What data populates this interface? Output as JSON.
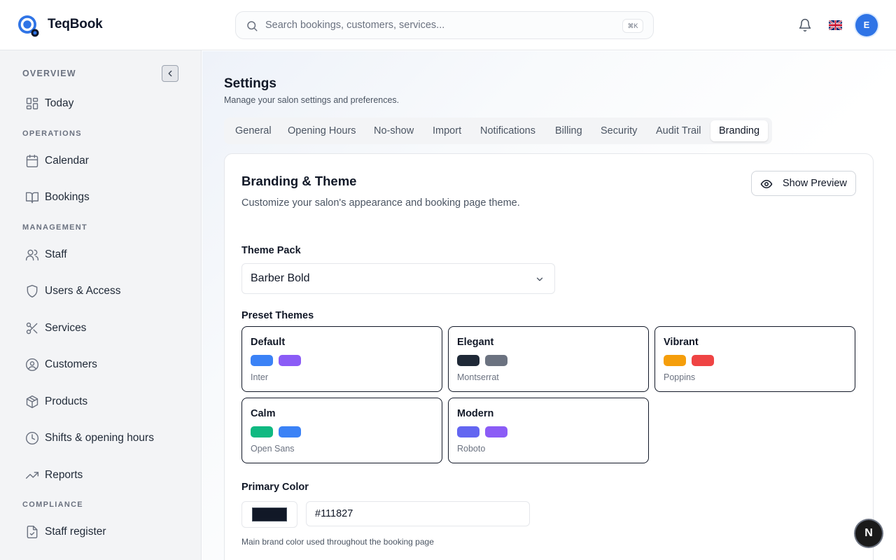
{
  "app": {
    "name": "TeqBook",
    "brand_color": "#2f74e6"
  },
  "header": {
    "search_placeholder": "Search bookings, customers, services...",
    "search_shortcut": "⌘K",
    "avatar_initial": "E",
    "language_flag": "uk-flag-icon"
  },
  "sidebar": {
    "sections": {
      "overview": "OVERVIEW",
      "operations": "OPERATIONS",
      "management": "MANAGEMENT",
      "compliance": "COMPLIANCE"
    },
    "items": {
      "today": "Today",
      "calendar": "Calendar",
      "bookings": "Bookings",
      "staff": "Staff",
      "users_access": "Users & Access",
      "services": "Services",
      "customers": "Customers",
      "products": "Products",
      "shifts": "Shifts & opening hours",
      "reports": "Reports",
      "staff_register": "Staff register"
    }
  },
  "page": {
    "title": "Settings",
    "subtitle": "Manage your salon settings and preferences."
  },
  "tabs": [
    "General",
    "Opening Hours",
    "No-show",
    "Import",
    "Notifications",
    "Billing",
    "Security",
    "Audit Trail",
    "Branding"
  ],
  "active_tab": "Branding",
  "branding": {
    "title": "Branding & Theme",
    "subtitle": "Customize your salon's appearance and booking page theme.",
    "preview_button": "Show Preview",
    "theme_pack_label": "Theme Pack",
    "theme_pack_value": "Barber Bold",
    "preset_label": "Preset Themes",
    "presets": [
      {
        "name": "Default",
        "font": "Inter",
        "colors": [
          "#3b82f6",
          "#8b5cf6"
        ]
      },
      {
        "name": "Elegant",
        "font": "Montserrat",
        "colors": [
          "#1f2937",
          "#6b7280"
        ]
      },
      {
        "name": "Vibrant",
        "font": "Poppins",
        "colors": [
          "#f59e0b",
          "#ef4444"
        ]
      },
      {
        "name": "Calm",
        "font": "Open Sans",
        "colors": [
          "#10b981",
          "#3b82f6"
        ]
      },
      {
        "name": "Modern",
        "font": "Roboto",
        "colors": [
          "#6366f1",
          "#8b5cf6"
        ]
      }
    ],
    "primary_color_label": "Primary Color",
    "primary_color_value": "#111827",
    "primary_color_help": "Main brand color used throughout the booking page"
  },
  "floating_badge": "N"
}
